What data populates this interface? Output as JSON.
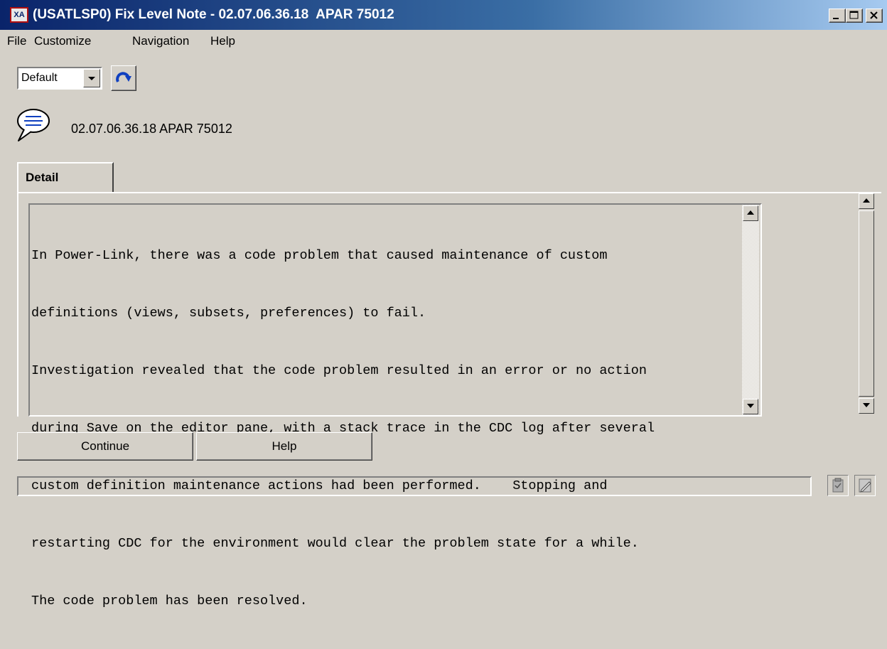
{
  "window": {
    "app_icon_text": "XA",
    "title": "(USATLSP0) Fix Level Note - 02.07.06.36.18  APAR 75012",
    "controls": [
      "minimize-icon",
      "maximize-icon",
      "close-icon"
    ]
  },
  "menu": {
    "items": [
      {
        "label": "File"
      },
      {
        "label": "Customize"
      },
      {
        "label": "Navigation"
      },
      {
        "label": "Help"
      }
    ]
  },
  "toolbar": {
    "view_select": {
      "value": "Default"
    },
    "refresh_icon": "refresh-arrow-icon"
  },
  "header": {
    "icon": "speech-bubble-icon",
    "text": "02.07.06.36.18  APAR 75012"
  },
  "tabs": [
    {
      "label": "Detail",
      "active": true
    }
  ],
  "detail": {
    "lines": [
      "In Power-Link, there was a code problem that caused maintenance of custom",
      "definitions (views, subsets, preferences) to fail.",
      "Investigation revealed that the code problem resulted in an error or no action",
      "during Save on the editor pane, with a stack trace in the CDC log after several",
      "custom definition maintenance actions had been performed.    Stopping and",
      "restarting CDC for the environment would clear the problem state for a while.",
      "The code problem has been resolved."
    ]
  },
  "buttons": {
    "continue": "Continue",
    "help": "Help"
  },
  "status": {
    "text": "",
    "icons": [
      "clipboard-icon",
      "edit-document-icon"
    ]
  },
  "colors": {
    "title_gradient_start": "#0a246a",
    "title_gradient_end": "#a6caf0",
    "window_bg": "#d4d0c8",
    "accent_blue": "#1040c0"
  }
}
